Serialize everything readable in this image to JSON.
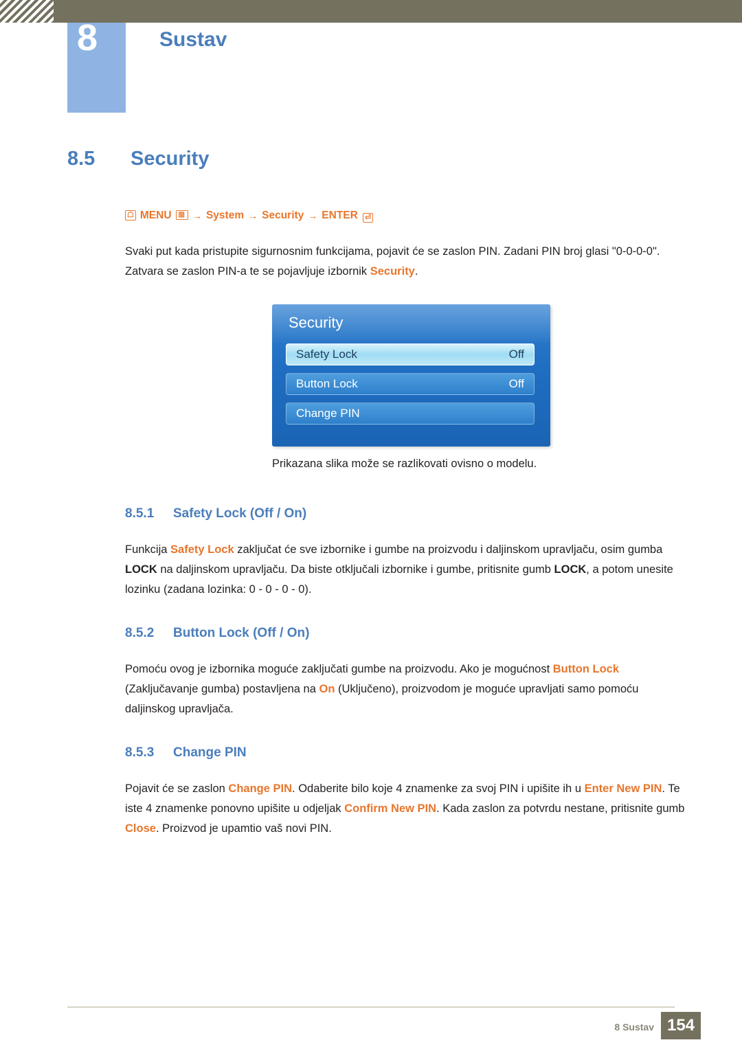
{
  "header": {
    "chapter_number": "8",
    "chapter_title": "Sustav"
  },
  "section": {
    "number": "8.5",
    "title": "Security"
  },
  "menu_path": {
    "menu_label": "MENU",
    "arrow": "→",
    "system_label": "System",
    "security_label": "Security",
    "enter_label": "ENTER",
    "menu_icon": "m",
    "dots_icon": "III",
    "enter_icon": "↵"
  },
  "intro": {
    "text_1": "Svaki put kada pristupite sigurnosnim funkcijama, pojavit će se zaslon PIN. Zadani PIN broj glasi \"0-0-0-0\". Zatvara se zaslon PIN-a te se pojavljuje izbornik ",
    "highlight_1": "Security",
    "text_2": "."
  },
  "osd": {
    "title": "Security",
    "rows": [
      {
        "label": "Safety Lock",
        "value": "Off"
      },
      {
        "label": "Button Lock",
        "value": "Off"
      },
      {
        "label": "Change PIN",
        "value": ""
      }
    ],
    "caption": "Prikazana slika može se razlikovati ovisno o modelu."
  },
  "subsections": [
    {
      "number": "8.5.1",
      "title": "Safety Lock (Off / On)",
      "paragraph": {
        "p1": "Funkcija ",
        "h1": "Safety Lock",
        "p2": " zaključat će sve izbornike i gumbe na proizvodu i daljinskom upravljaču, osim gumba ",
        "h2": "LOCK",
        "p3": " na daljinskom upravljaču. Da biste otključali izbornike i gumbe, pritisnite gumb ",
        "h3": "LOCK",
        "p4": ", a potom unesite lozinku (zadana lozinka: 0 - 0 - 0 - 0)."
      }
    },
    {
      "number": "8.5.2",
      "title": "Button Lock (Off / On)",
      "paragraph": {
        "p1": "Pomoću ovog je izbornika moguće zaključati gumbe na proizvodu. Ako je mogućnost ",
        "h1": "Button Lock",
        "p2": " (Zaključavanje gumba) postavljena na ",
        "h2": "On",
        "p3": " (Uključeno), proizvodom je moguće upravljati samo pomoću daljinskog upravljača."
      }
    },
    {
      "number": "8.5.3",
      "title": "Change PIN",
      "paragraph": {
        "p1": "Pojavit će se zaslon ",
        "h1": "Change PIN",
        "p2": ". Odaberite bilo koje 4 znamenke za svoj PIN i upišite ih u ",
        "h2": "Enter New PIN",
        "p3": ". Te iste 4 znamenke ponovno upišite u odjeljak ",
        "h3": "Confirm New PIN",
        "p4": ". Kada zaslon za potvrdu nestane, pritisnite gumb ",
        "h4": "Close",
        "p5": ". Proizvod je upamtio vaš novi PIN."
      }
    }
  ],
  "footer": {
    "text": "8 Sustav",
    "page": "154"
  }
}
